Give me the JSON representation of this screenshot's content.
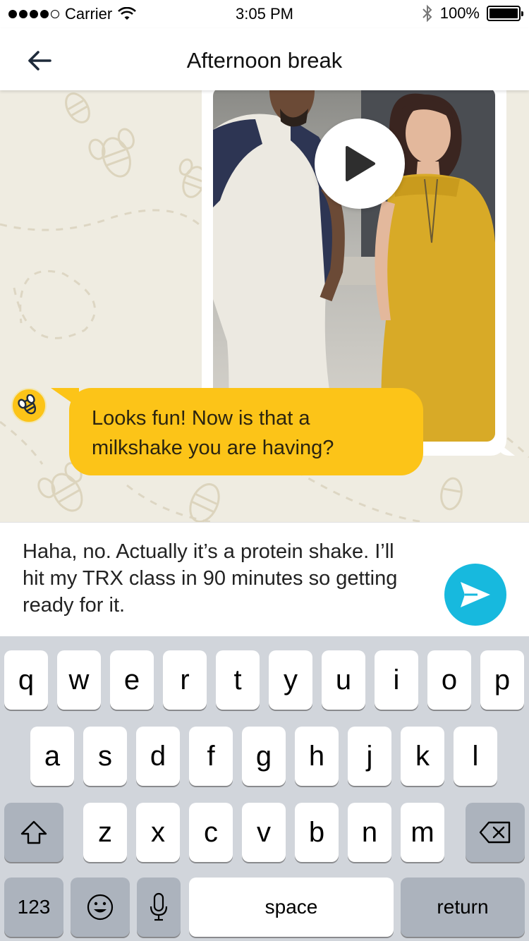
{
  "status_bar": {
    "carrier": "Carrier",
    "time": "3:05 PM",
    "battery_text": "100%",
    "signal_bars": 4
  },
  "nav": {
    "title": "Afternoon break",
    "back_icon": "arrow-left-icon"
  },
  "chat": {
    "video_message": {
      "play_icon": "play-icon"
    },
    "bot_message": {
      "avatar_icon": "bee-icon",
      "text_line1": "Looks fun! Now is that a",
      "text_line2": "milkshake you are having?"
    },
    "colors": {
      "bot_bubble": "#fcc418",
      "background": "#efece1"
    }
  },
  "composer": {
    "line1": "Haha, no. Actually it’s a protein shake. I’ll",
    "line2": "hit my TRX class in 90 minutes so getting",
    "line3": "ready for it.",
    "send_icon": "send-icon",
    "send_color": "#17b9de"
  },
  "keyboard": {
    "row1": [
      "q",
      "w",
      "e",
      "r",
      "t",
      "y",
      "u",
      "i",
      "o",
      "p"
    ],
    "row2": [
      "a",
      "s",
      "d",
      "f",
      "g",
      "h",
      "j",
      "k",
      "l"
    ],
    "row3": [
      "z",
      "x",
      "c",
      "v",
      "b",
      "n",
      "m"
    ],
    "numbers_label": "123",
    "space_label": "space",
    "return_label": "return"
  }
}
